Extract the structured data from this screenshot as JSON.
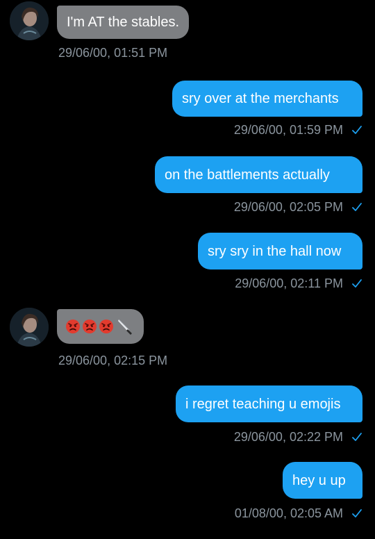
{
  "colors": {
    "background": "#000000",
    "incoming_bubble": "#7d7f82",
    "outgoing_bubble": "#1da1f2",
    "timestamp": "#8b959e",
    "checkmark": "#1da1f2",
    "text": "#ffffff"
  },
  "messages": [
    {
      "direction": "incoming",
      "text": "I'm AT the stables.",
      "timestamp": "29/06/00, 01:51 PM",
      "avatar": "contact-avatar"
    },
    {
      "direction": "outgoing",
      "text": "sry over at the merchants",
      "timestamp": "29/06/00, 01:59 PM",
      "status_icon": "checkmark-icon"
    },
    {
      "direction": "outgoing",
      "text": "on the battlements actually",
      "timestamp": "29/06/00, 02:05 PM",
      "status_icon": "checkmark-icon"
    },
    {
      "direction": "outgoing",
      "text": "sry sry in the hall now",
      "timestamp": "29/06/00, 02:11 PM",
      "status_icon": "checkmark-icon"
    },
    {
      "direction": "incoming",
      "emojis": [
        "angry-face-emoji",
        "angry-face-emoji",
        "angry-face-emoji",
        "knife-emoji"
      ],
      "timestamp": "29/06/00, 02:15 PM",
      "avatar": "contact-avatar"
    },
    {
      "direction": "outgoing",
      "text": "i regret teaching u emojis",
      "timestamp": "29/06/00, 02:22 PM",
      "status_icon": "checkmark-icon"
    },
    {
      "direction": "outgoing",
      "text": "hey u up",
      "timestamp": "01/08/00, 02:05 AM",
      "status_icon": "checkmark-icon"
    }
  ]
}
